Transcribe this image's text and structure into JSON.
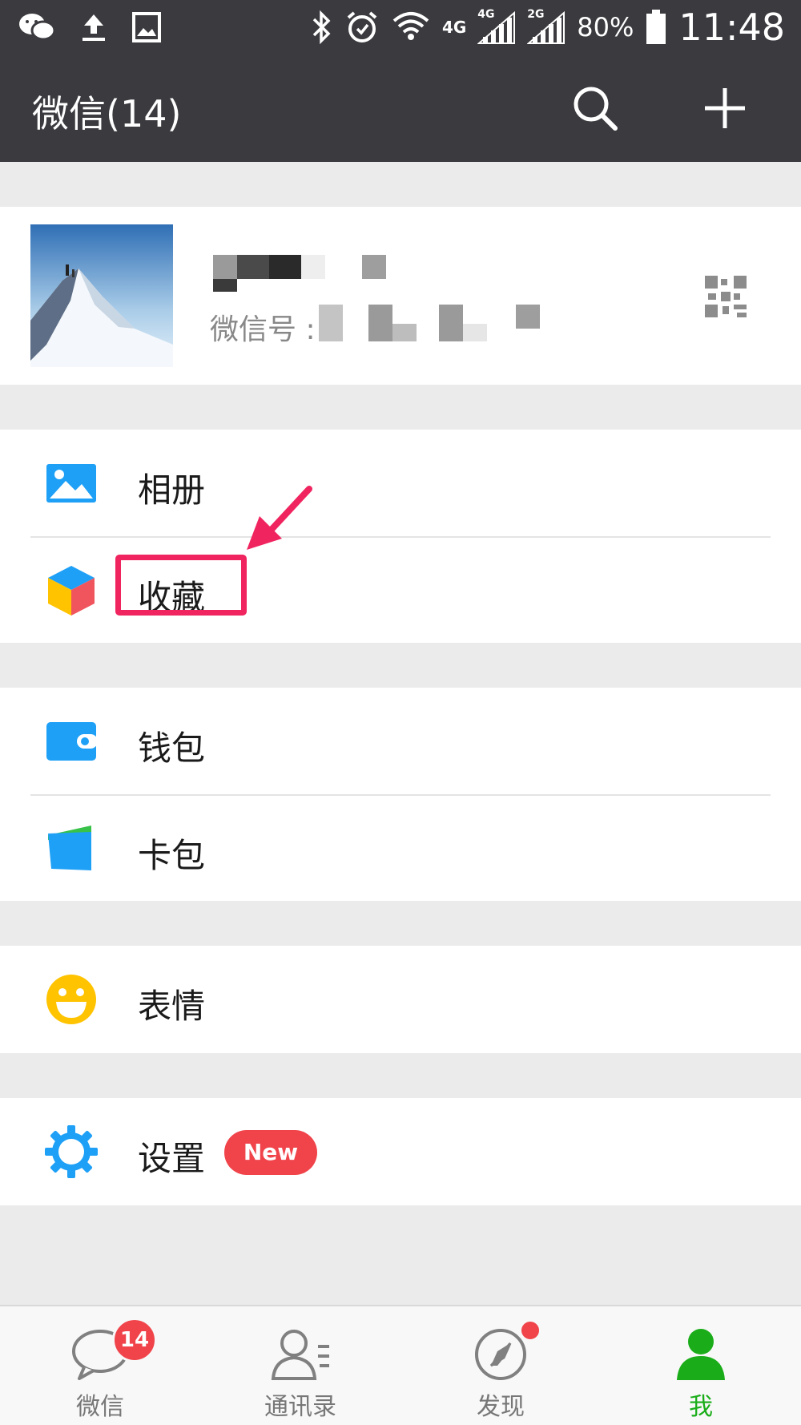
{
  "status_bar": {
    "battery": "80%",
    "time": "11:48",
    "network_1": "4G",
    "network_2": "4G",
    "network_3": "2G",
    "icons": [
      "wechat-icon",
      "upload-icon",
      "image-icon",
      "bluetooth-icon",
      "alarm-icon",
      "wifi-icon",
      "signal-icon",
      "battery-icon"
    ]
  },
  "header": {
    "title": "微信(14)",
    "search_icon": "search-icon",
    "add_icon": "plus-icon"
  },
  "profile": {
    "wechat_id_label": "微信号 :",
    "qr_icon": "qr-code-icon"
  },
  "menu": {
    "album": "相册",
    "favorites": "收藏",
    "wallet": "钱包",
    "cards": "卡包",
    "stickers": "表情",
    "settings": "设置",
    "settings_badge": "New"
  },
  "tabs": [
    {
      "label": "微信",
      "badge": "14",
      "icon": "chat-icon"
    },
    {
      "label": "通讯录",
      "icon": "contacts-icon"
    },
    {
      "label": "发现",
      "icon": "compass-icon"
    },
    {
      "label": "我",
      "icon": "me-icon"
    }
  ],
  "colors": {
    "header_bg": "#3a3a3f",
    "accent_green": "#1aad19",
    "badge_red": "#f0434a",
    "highlight_pink": "#f0245f",
    "icon_blue": "#1ea0f7"
  }
}
